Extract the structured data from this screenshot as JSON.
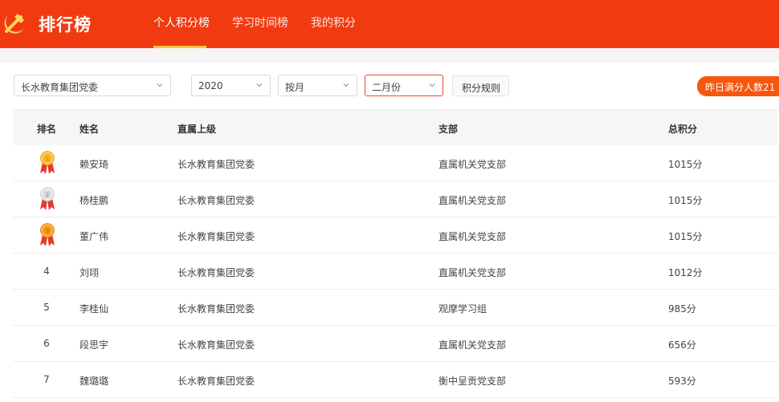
{
  "header": {
    "title": "排行榜",
    "tabs": [
      {
        "label": "个人积分榜",
        "active": true
      },
      {
        "label": "学习时间榜",
        "active": false
      },
      {
        "label": "我的积分",
        "active": false
      }
    ],
    "brand_color": "#f23a10"
  },
  "filters": {
    "org": "长水教育集团党委",
    "year": "2020",
    "period": "按月",
    "month": "二月份",
    "rules_label": "积分规则"
  },
  "badge": {
    "label": "昨日满分人数21"
  },
  "table": {
    "columns": [
      "排名",
      "姓名",
      "直属上级",
      "支部",
      "总积分"
    ],
    "rows": [
      {
        "rank": "1",
        "medal": "gold",
        "name": "赖安琦",
        "superior": "长水教育集团党委",
        "branch": "直属机关党支部",
        "score": "1015分"
      },
      {
        "rank": "2",
        "medal": "silver",
        "name": "杨桂鹏",
        "superior": "长水教育集团党委",
        "branch": "直属机关党支部",
        "score": "1015分"
      },
      {
        "rank": "3",
        "medal": "bronze",
        "name": "董广伟",
        "superior": "长水教育集团党委",
        "branch": "直属机关党支部",
        "score": "1015分"
      },
      {
        "rank": "4",
        "name": "刘翊",
        "superior": "长水教育集团党委",
        "branch": "直属机关党支部",
        "score": "1012分"
      },
      {
        "rank": "5",
        "name": "李桂仙",
        "superior": "长水教育集团党委",
        "branch": "观摩学习组",
        "score": "985分"
      },
      {
        "rank": "6",
        "name": "段思宇",
        "superior": "长水教育集团党委",
        "branch": "直属机关党支部",
        "score": "656分"
      },
      {
        "rank": "7",
        "name": "魏璐璐",
        "superior": "长水教育集团党委",
        "branch": "衡中呈贡党支部",
        "score": "593分"
      }
    ]
  }
}
